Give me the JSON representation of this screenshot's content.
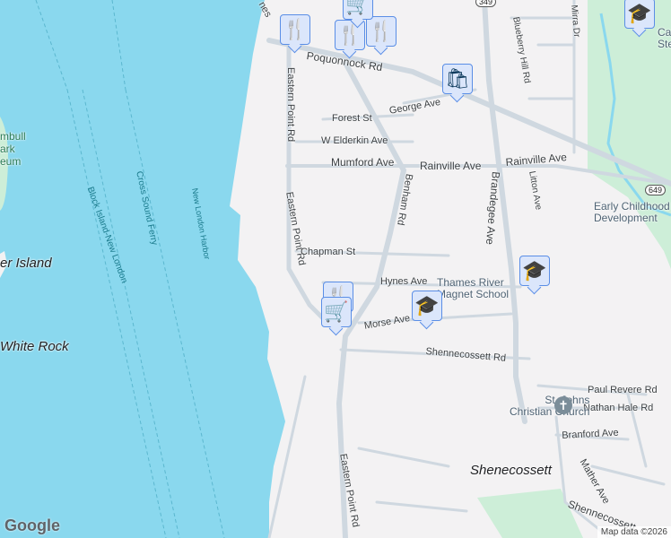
{
  "water_labels": {
    "ferry1": "Block Island-New London",
    "ferry2": "Cross Sound Ferry",
    "harbor": "New London Harbor"
  },
  "places": {
    "trumbull": "mbull\nark\neum",
    "fisher": "er Island",
    "white_rock": "White Rock",
    "shenecossett": "Shenecossett"
  },
  "streets": {
    "eastern_point_1": "Eastern Point Rd",
    "eastern_point_2": "Eastern Point Rd",
    "eastern_point_3": "Eastern Point Rd",
    "poquonnock": "Poquonnock Rd",
    "forest": "Forest St",
    "george": "George Ave",
    "elderkin": "W Elderkin Ave",
    "mumford": "Mumford Ave",
    "rainville_1": "Rainville Ave",
    "rainville_2": "Rainville Ave",
    "benham": "Benham Rd",
    "brandegee": "Brandegee Ave",
    "blueberry": "Blueberry Hill Rd",
    "mirra": "Mirra Dr",
    "litton": "Litton Ave",
    "chapman": "Chapman St",
    "hynes": "Hynes Ave",
    "morse": "Morse Ave",
    "shennecossett_rd": "Shennecossett Rd",
    "paul_revere": "Paul Revere Rd",
    "nathan_hale": "Nathan Hale Rd",
    "branford": "Branford Ave",
    "mather": "Mather Ave",
    "shennecossett_2": "Shennecossett",
    "shores": "nes"
  },
  "pois": {
    "thames": "Thames River\nMagnet School",
    "early_childhood": "Early Childhood\nDevelopment",
    "st_johns": "St. Johns\nChristian Church",
    "ca": "Ca\nSte"
  },
  "shields": {
    "r349": "349",
    "r649": "649"
  },
  "markers": [
    {
      "type": "restaurant",
      "icon": "🍴"
    },
    {
      "type": "restaurant",
      "icon": "🍴"
    },
    {
      "type": "restaurant",
      "icon": "🍴"
    },
    {
      "type": "grocery",
      "icon": "🛒"
    },
    {
      "type": "shopping",
      "icon": "🛍"
    },
    {
      "type": "school",
      "icon": "🎓"
    },
    {
      "type": "school",
      "icon": "🎓"
    },
    {
      "type": "school",
      "icon": "🎓"
    },
    {
      "type": "restaurant",
      "icon": "🍴"
    },
    {
      "type": "grocery",
      "icon": "🛒"
    }
  ],
  "branding": {
    "logo": "Google",
    "attribution": "Map data ©2026"
  },
  "colors": {
    "water": "#8ad8ee",
    "land": "#f3f2f3",
    "park": "#cdeed8",
    "road": "#cfd8e0",
    "marker": "#dbe6fb"
  }
}
